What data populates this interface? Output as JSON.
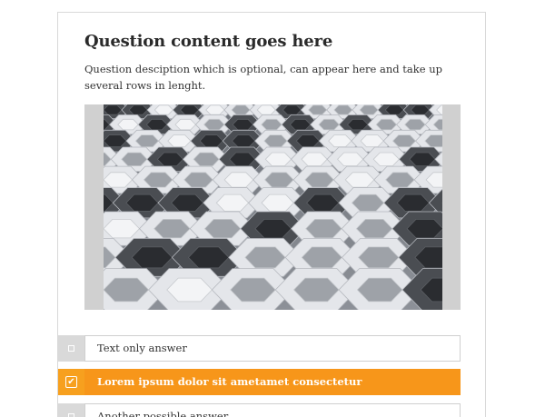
{
  "question": {
    "title": "Question content goes here",
    "description": "Question desciption which is optional, can appear here and take up several rows in lenght."
  },
  "media": {
    "icon": "hexagon-pattern-image",
    "background_color": "#d0d0d0"
  },
  "answers": [
    {
      "label": "Text only answer",
      "selected": false
    },
    {
      "label": "Lorem ipsum dolor sit ametamet consectetur",
      "selected": true
    },
    {
      "label": "Another possible answer",
      "selected": false
    }
  ],
  "colors": {
    "accent": "#f7961a",
    "checkbox_unselected": "#d9d9d9",
    "border": "#cfcfcf"
  }
}
